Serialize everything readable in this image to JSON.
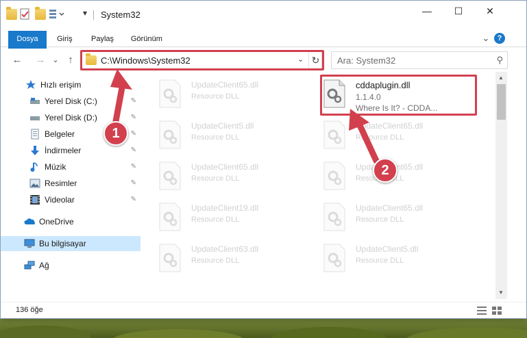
{
  "window": {
    "title": "System32",
    "controls": {
      "minimize": "—",
      "maximize": "☐",
      "close": "✕"
    }
  },
  "ribbon": {
    "tabs": [
      {
        "label": "Dosya"
      },
      {
        "label": "Giriş"
      },
      {
        "label": "Paylaş"
      },
      {
        "label": "Görünüm"
      }
    ],
    "expand_glyph": "⌄",
    "help_glyph": "?"
  },
  "nav": {
    "back": "←",
    "forward": "→",
    "recent": "⌄",
    "up": "↑"
  },
  "address": {
    "path": "C:\\Windows\\System32",
    "dropdown_glyph": "⌄",
    "refresh_glyph": "↻"
  },
  "search": {
    "placeholder": "Ara: System32",
    "icon_glyph": "⚲"
  },
  "sidebar": {
    "items": [
      {
        "label": "Hızlı erişim",
        "icon": "star-icon",
        "pinned": false
      },
      {
        "label": "Yerel Disk (C:)",
        "icon": "drive-icon",
        "pinned": true
      },
      {
        "label": "Yerel Disk (D:)",
        "icon": "drive-icon",
        "pinned": true
      },
      {
        "label": "Belgeler",
        "icon": "documents-icon",
        "pinned": true
      },
      {
        "label": "İndirmeler",
        "icon": "downloads-icon",
        "pinned": true
      },
      {
        "label": "Müzik",
        "icon": "music-icon",
        "pinned": true
      },
      {
        "label": "Resimler",
        "icon": "pictures-icon",
        "pinned": true
      },
      {
        "label": "Videolar",
        "icon": "videos-icon",
        "pinned": true
      },
      {
        "label": "OneDrive",
        "icon": "onedrive-icon",
        "pinned": false
      },
      {
        "label": "Bu bilgisayar",
        "icon": "computer-icon",
        "pinned": false
      },
      {
        "label": "Ağ",
        "icon": "network-icon",
        "pinned": false
      }
    ],
    "pin_glyph": "📌"
  },
  "files": [
    {
      "name": "UpdateClient65.dll",
      "desc": "Resource DLL",
      "faded": true
    },
    {
      "name": "cddaplugin.dll",
      "desc": "1.1.4.0",
      "desc2": "Where Is It? - CDDA...",
      "faded": false
    },
    {
      "name": "UpdateClient5.dll",
      "desc": "Resource DLL",
      "faded": true
    },
    {
      "name": "UpdateClient65.dll",
      "desc": "Resource DLL",
      "faded": true
    },
    {
      "name": "UpdateClient65.dll",
      "desc": "Resource DLL",
      "faded": true
    },
    {
      "name": "UpdateClient65.dll",
      "desc": "Resource DLL",
      "faded": true
    },
    {
      "name": "UpdateClient19.dll",
      "desc": "Resource DLL",
      "faded": true
    },
    {
      "name": "UpdateClient65.dll",
      "desc": "Resource DLL",
      "faded": true
    },
    {
      "name": "UpdateClient63.dll",
      "desc": "Resource DLL",
      "faded": true
    },
    {
      "name": "UpdateClient5.dll",
      "desc": "Resource DLL",
      "faded": true
    }
  ],
  "status": {
    "count": "136 öğe"
  },
  "callouts": {
    "step1": "1",
    "step2": "2"
  },
  "colors": {
    "accent": "#1979ca",
    "callout": "#d2404e",
    "selected": "#cce8ff"
  }
}
